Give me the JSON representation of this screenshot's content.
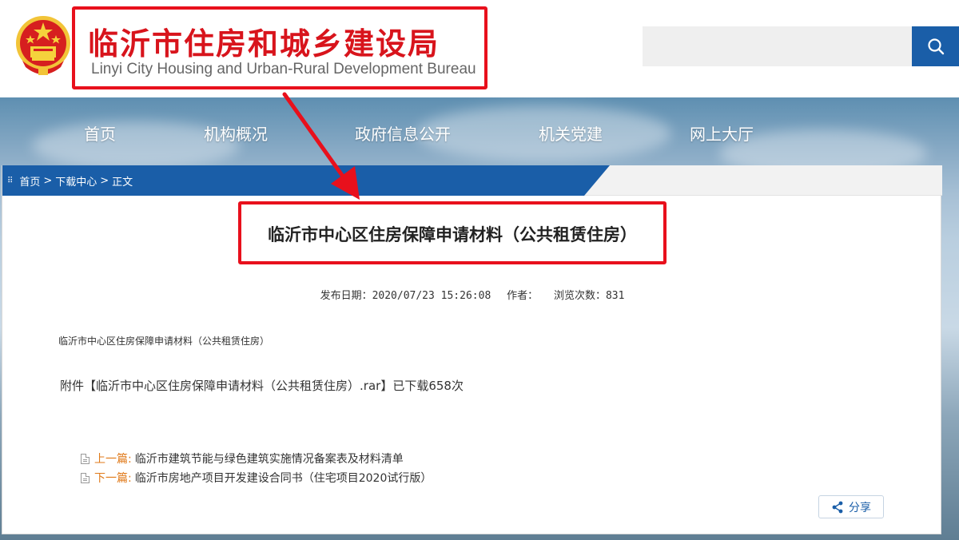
{
  "header": {
    "site_title": "临沂市住房和城乡建设局",
    "site_subtitle": "Linyi City Housing and Urban-Rural Development Bureau",
    "search_placeholder": "",
    "search_icon": "search-icon"
  },
  "nav": {
    "items": [
      {
        "label": "首页"
      },
      {
        "label": "机构概况"
      },
      {
        "label": "政府信息公开"
      },
      {
        "label": "机关党建"
      },
      {
        "label": "网上大厅"
      }
    ]
  },
  "breadcrumb": {
    "home": "首页",
    "sep1": ">",
    "section": "下载中心",
    "sep2": ">",
    "current": "正文"
  },
  "article": {
    "title": "临沂市中心区住房保障申请材料（公共租赁住房）",
    "publish_label": "发布日期：2020/07/23 15:26:08",
    "author_label": "作者：",
    "views_label": "浏览次数：831",
    "body_text": "临沂市中心区住房保障申请材料（公共租赁住房）",
    "attachment_prefix": "附件【",
    "attachment_name": "临沂市中心区住房保障申请材料（公共租赁住房）.rar",
    "attachment_suffix": "】已下载658次"
  },
  "pager": {
    "prev_label": "上一篇:",
    "prev_title": "临沂市建筑节能与绿色建筑实施情况备案表及材料清单",
    "next_label": "下一篇:",
    "next_title": "临沂市房地产项目开发建设合同书（住宅项目2020试行版）"
  },
  "share": {
    "label": "分享",
    "icon": "share-icon"
  },
  "colors": {
    "highlight_red": "#e8101c",
    "title_red": "#d8141c",
    "brand_blue": "#1a5ea8",
    "pager_orange": "#e07a1a"
  }
}
